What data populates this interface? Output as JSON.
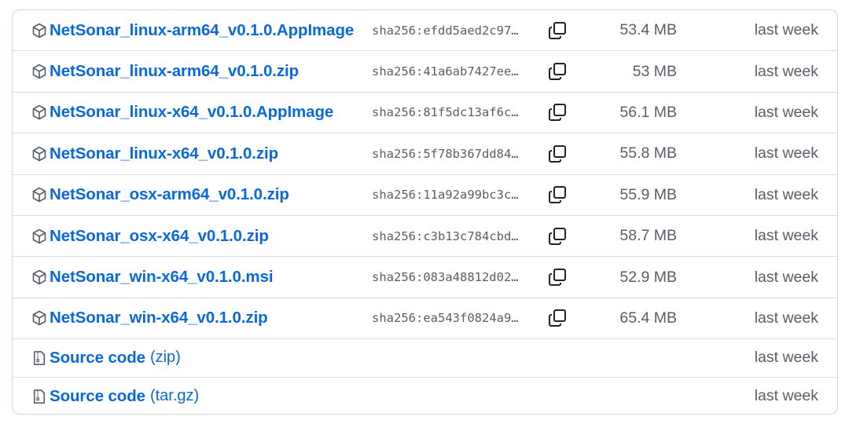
{
  "assets": [
    {
      "name": "NetSonar_linux-arm64_v0.1.0.AppImage",
      "sha": "sha256:efdd5aed2c97…",
      "size": "53.4 MB",
      "date": "last week",
      "icon": "package-icon"
    },
    {
      "name": "NetSonar_linux-arm64_v0.1.0.zip",
      "sha": "sha256:41a6ab7427ee…",
      "size": "53 MB",
      "date": "last week",
      "icon": "package-icon"
    },
    {
      "name": "NetSonar_linux-x64_v0.1.0.AppImage",
      "sha": "sha256:81f5dc13af6c…",
      "size": "56.1 MB",
      "date": "last week",
      "icon": "package-icon"
    },
    {
      "name": "NetSonar_linux-x64_v0.1.0.zip",
      "sha": "sha256:5f78b367dd84…",
      "size": "55.8 MB",
      "date": "last week",
      "icon": "package-icon"
    },
    {
      "name": "NetSonar_osx-arm64_v0.1.0.zip",
      "sha": "sha256:11a92a99bc3c…",
      "size": "55.9 MB",
      "date": "last week",
      "icon": "package-icon"
    },
    {
      "name": "NetSonar_osx-x64_v0.1.0.zip",
      "sha": "sha256:c3b13c784cbd…",
      "size": "58.7 MB",
      "date": "last week",
      "icon": "package-icon"
    },
    {
      "name": "NetSonar_win-x64_v0.1.0.msi",
      "sha": "sha256:083a48812d02…",
      "size": "52.9 MB",
      "date": "last week",
      "icon": "package-icon"
    },
    {
      "name": "NetSonar_win-x64_v0.1.0.zip",
      "sha": "sha256:ea543f0824a9…",
      "size": "65.4 MB",
      "date": "last week",
      "icon": "package-icon"
    }
  ],
  "source_code": [
    {
      "label": "Source code",
      "suffix": "(zip)",
      "date": "last week",
      "icon": "file-zip-icon"
    },
    {
      "label": "Source code",
      "suffix": "(tar.gz)",
      "date": "last week",
      "icon": "file-zip-icon"
    }
  ],
  "colors": {
    "link": "#0969da",
    "muted": "#57606a",
    "border": "#d0d7de"
  }
}
